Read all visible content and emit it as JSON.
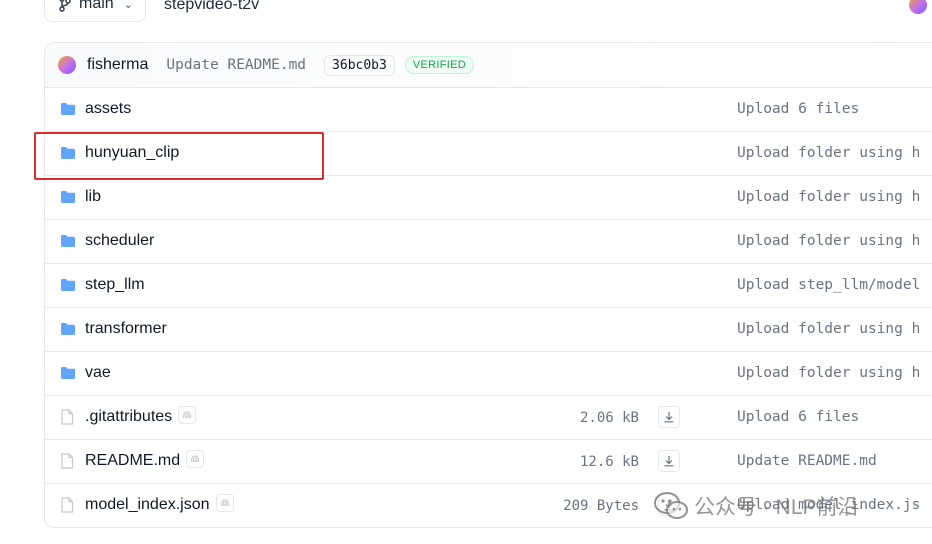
{
  "header": {
    "branch": "main",
    "repo_path": "stepvideo-t2v"
  },
  "commit": {
    "author": "fisherma",
    "message": "Update README.md",
    "sha": "36bc0b3",
    "badge": "VERIFIED"
  },
  "files": [
    {
      "name": "assets",
      "type": "folder",
      "size": "",
      "message": "Upload 6 files"
    },
    {
      "name": "hunyuan_clip",
      "type": "folder",
      "size": "",
      "message": "Upload folder using h"
    },
    {
      "name": "lib",
      "type": "folder",
      "size": "",
      "message": "Upload folder using h"
    },
    {
      "name": "scheduler",
      "type": "folder",
      "size": "",
      "message": "Upload folder using h"
    },
    {
      "name": "step_llm",
      "type": "folder",
      "size": "",
      "message": "Upload step_llm/model"
    },
    {
      "name": "transformer",
      "type": "folder",
      "size": "",
      "message": "Upload folder using h"
    },
    {
      "name": "vae",
      "type": "folder",
      "size": "",
      "message": "Upload folder using h"
    },
    {
      "name": ".gitattributes",
      "type": "file",
      "size": "2.06 kB",
      "message": "Upload 6 files"
    },
    {
      "name": "README.md",
      "type": "file",
      "size": "12.6 kB",
      "message": "Update README.md"
    },
    {
      "name": "model_index.json",
      "type": "file",
      "size": "209 Bytes",
      "message": "Upload model_index.js"
    }
  ],
  "watermark": "公众号 · NLP前沿",
  "colors": {
    "folder_icon": "#60a5fa",
    "highlight_box": "#d62d2d",
    "verified_text": "#16a34a"
  }
}
